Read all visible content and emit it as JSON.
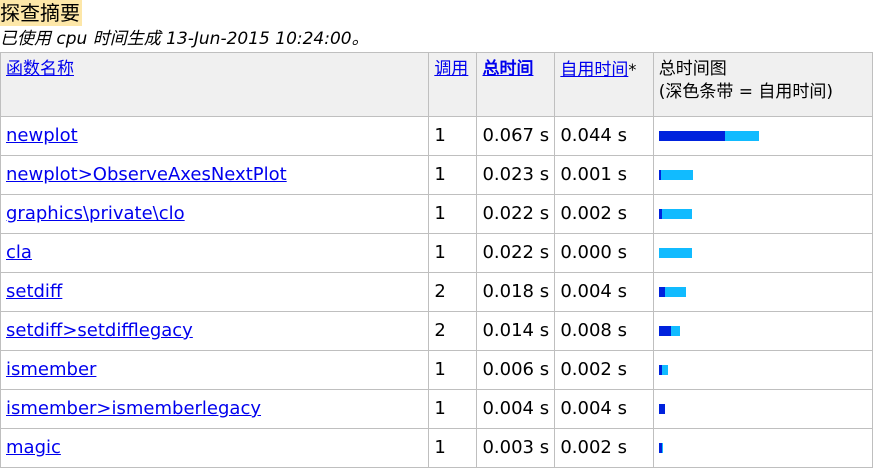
{
  "page": {
    "title": "探查摘要",
    "summary": "已使用 cpu 时间生成 13-Jun-2015 10:24:00。"
  },
  "table": {
    "headers": {
      "name": "函数名称",
      "calls": "调用",
      "total": "总时间",
      "self": "自用时间",
      "self_suffix": "*",
      "graph_line1": "总时间图",
      "graph_line2": "(深色条带 = 自用时间)"
    },
    "colors": {
      "self_bar": "#0022dd",
      "total_bar": "#11bbff"
    },
    "rows": [
      {
        "name": "newplot",
        "calls": "1",
        "total": "0.067 s",
        "self": "0.044 s",
        "total_value": 0.067,
        "self_value": 0.044
      },
      {
        "name": "newplot>ObserveAxesNextPlot",
        "calls": "1",
        "total": "0.023 s",
        "self": "0.001 s",
        "total_value": 0.023,
        "self_value": 0.001
      },
      {
        "name": "graphics\\private\\clo",
        "calls": "1",
        "total": "0.022 s",
        "self": "0.002 s",
        "total_value": 0.022,
        "self_value": 0.002
      },
      {
        "name": "cla",
        "calls": "1",
        "total": "0.022 s",
        "self": "0.000 s",
        "total_value": 0.022,
        "self_value": 0.0
      },
      {
        "name": "setdiff",
        "calls": "2",
        "total": "0.018 s",
        "self": "0.004 s",
        "total_value": 0.018,
        "self_value": 0.004
      },
      {
        "name": "setdiff>setdifflegacy",
        "calls": "2",
        "total": "0.014 s",
        "self": "0.008 s",
        "total_value": 0.014,
        "self_value": 0.008
      },
      {
        "name": "ismember",
        "calls": "1",
        "total": "0.006 s",
        "self": "0.002 s",
        "total_value": 0.006,
        "self_value": 0.002
      },
      {
        "name": "ismember>ismemberlegacy",
        "calls": "1",
        "total": "0.004 s",
        "self": "0.004 s",
        "total_value": 0.004,
        "self_value": 0.004
      },
      {
        "name": "magic",
        "calls": "1",
        "total": "0.003 s",
        "self": "0.002 s",
        "total_value": 0.003,
        "self_value": 0.002
      }
    ]
  }
}
